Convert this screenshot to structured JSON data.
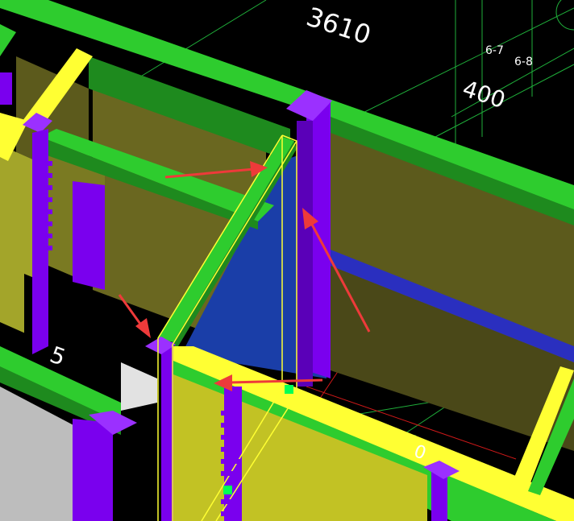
{
  "viewport": {
    "dimension_main": "3610",
    "dimension_secondary": "400",
    "axis_labels": [
      "6-7",
      "6-8"
    ],
    "partial_label_left": "5",
    "partial_label_bottom": "0"
  },
  "colors": {
    "background": "#000000",
    "beam_green": "#2ecc2e",
    "beam_green_dark": "#1e8a1e",
    "beam_yellow": "#ffff33",
    "column_purple": "#7a00ee",
    "wall_olive": "#8f8f2a",
    "wall_olive_dark": "#5c5a1c",
    "wall_yellow": "#c2c224",
    "slab_blue": "#1a3ea8",
    "wall_grey": "#bdbdbd",
    "grid_green": "#1fae3a",
    "grid_red": "#d01919",
    "selection_outline": "#ffff33",
    "grip": "#00ff55",
    "arrow": "#ee3a3a"
  }
}
